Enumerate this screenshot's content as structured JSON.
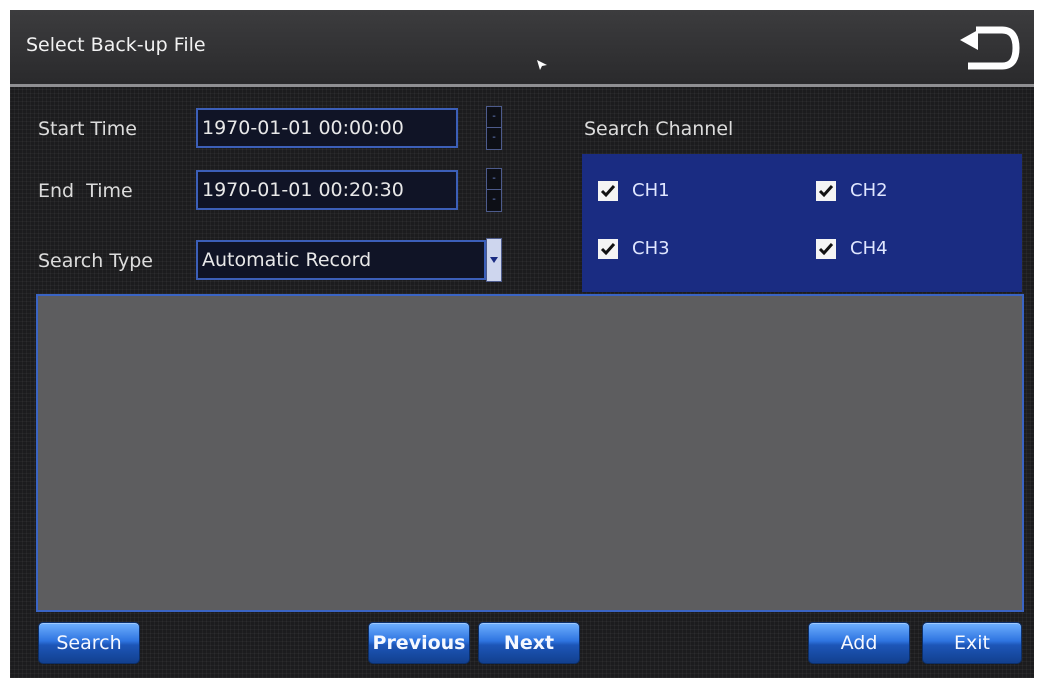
{
  "window": {
    "title": "Select Back-up File"
  },
  "form": {
    "start_time_label": "Start Time",
    "start_time_value": "1970-01-01 00:00:00",
    "end_time_label": "End  Time",
    "end_time_value": "1970-01-01 00:20:30",
    "search_type_label": "Search Type",
    "search_type_value": "Automatic Record"
  },
  "channels": {
    "label": "Search Channel",
    "items": [
      {
        "label": "CH1",
        "checked": true
      },
      {
        "label": "CH2",
        "checked": true
      },
      {
        "label": "CH3",
        "checked": true
      },
      {
        "label": "CH4",
        "checked": true
      }
    ]
  },
  "buttons": {
    "search": "Search",
    "previous": "Previous",
    "next": "Next",
    "add": "Add",
    "exit": "Exit"
  },
  "icons": {
    "back": "back-arrow-icon",
    "checkmark": "checkmark-icon",
    "dropdown": "dropdown-arrow-icon",
    "spinner": "spinner-icon",
    "cursor": "mouse-cursor-icon"
  },
  "colors": {
    "accent_blue": "#1a2c82",
    "button_blue": "#2e74e0",
    "field_border": "#3c5fb8",
    "result_area": "#5d5d5f"
  }
}
